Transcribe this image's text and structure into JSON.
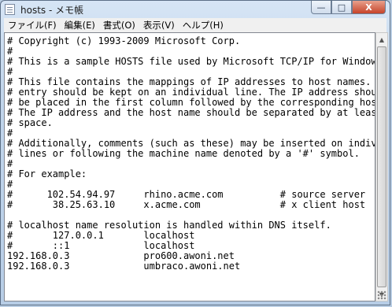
{
  "window": {
    "title": "hosts - メモ帳"
  },
  "buttons": {
    "minimize": "—",
    "maximize": "□",
    "close": "X"
  },
  "menu": [
    "ファイル(F)",
    "編集(E)",
    "書式(O)",
    "表示(V)",
    "ヘルプ(H)"
  ],
  "lines": [
    "# Copyright (c) 1993-2009 Microsoft Corp.",
    "#",
    "# This is a sample HOSTS file used by Microsoft TCP/IP for Windows.",
    "#",
    "# This file contains the mappings of IP addresses to host names. Each",
    "# entry should be kept on an individual line. The IP address should",
    "# be placed in the first column followed by the corresponding host name.",
    "# The IP address and the host name should be separated by at least one",
    "# space.",
    "#",
    "# Additionally, comments (such as these) may be inserted on individual",
    "# lines or following the machine name denoted by a '#' symbol.",
    "#",
    "# For example:",
    "#",
    "#      102.54.94.97     rhino.acme.com          # source server",
    "#       38.25.63.10     x.acme.com              # x client host",
    "",
    "# localhost name resolution is handled within DNS itself.",
    "#       127.0.0.1       localhost",
    "#       ::1             localhost",
    "192.168.0.3             pro600.awoni.net",
    "192.168.0.3             umbraco.awoni.net"
  ]
}
